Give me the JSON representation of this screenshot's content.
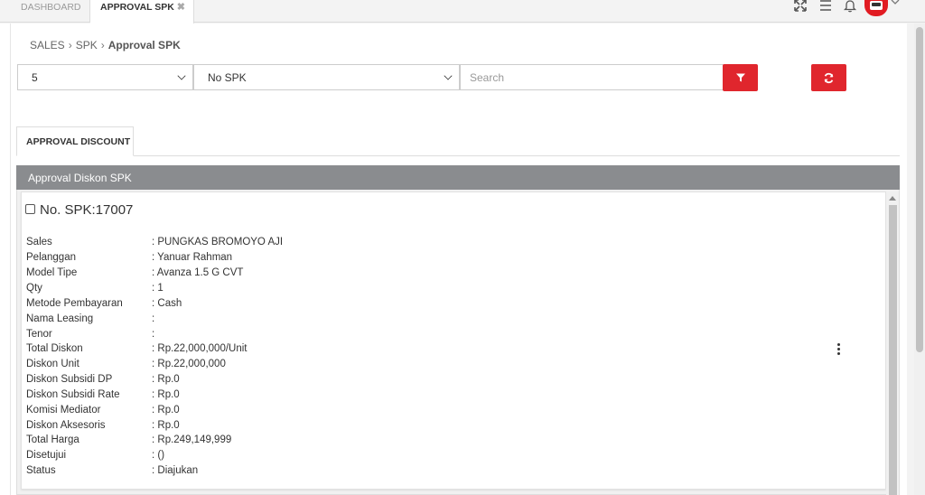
{
  "tabs": [
    {
      "label": "DASHBOARD",
      "active": false
    },
    {
      "label": "APPROVAL SPK",
      "active": true,
      "close": "✖"
    }
  ],
  "breadcrumb": [
    {
      "label": "SALES"
    },
    {
      "label": "SPK"
    },
    {
      "label": "Approval SPK"
    }
  ],
  "filters": {
    "page_size": "5",
    "field": "No SPK",
    "search_placeholder": "Search"
  },
  "subtab": {
    "label": "APPROVAL DISCOUNT"
  },
  "panel": {
    "title": "Approval Diskon SPK"
  },
  "spk": {
    "title": "No. SPK:17007",
    "details": [
      {
        "label": "Sales",
        "value": ": PUNGKAS BROMOYO AJI"
      },
      {
        "label": "Pelanggan",
        "value": ": Yanuar Rahman"
      },
      {
        "label": "Model Tipe",
        "value": ": Avanza 1.5 G CVT"
      },
      {
        "label": "Qty",
        "value": ": 1"
      },
      {
        "label": "Metode Pembayaran",
        "value": ": Cash"
      },
      {
        "label": "Nama Leasing",
        "value": ":"
      },
      {
        "label": "Tenor",
        "value": ":"
      },
      {
        "label": "Total Diskon",
        "value": ": Rp.22,000,000/Unit"
      },
      {
        "label": "Diskon Unit",
        "value": ": Rp.22,000,000"
      },
      {
        "label": "Diskon Subsidi DP",
        "value": ": Rp.0"
      },
      {
        "label": "Diskon Subsidi Rate",
        "value": ": Rp.0"
      },
      {
        "label": "Komisi Mediator",
        "value": ": Rp.0"
      },
      {
        "label": "Diskon Aksesoris",
        "value": ": Rp.0"
      },
      {
        "label": "Total Harga",
        "value": ": Rp.249,149,999"
      },
      {
        "label": "Disetujui",
        "value": ": ()"
      },
      {
        "label": "Status",
        "value": ": Diajukan"
      }
    ]
  },
  "colors": {
    "accent": "#e0262d",
    "header_grey": "#8a8c8f"
  },
  "icons": [
    "fullscreen-icon",
    "menu-icon",
    "bell-icon",
    "avatar",
    "chevron-down-icon",
    "filter-icon",
    "refresh-icon",
    "kebab-menu-icon"
  ]
}
